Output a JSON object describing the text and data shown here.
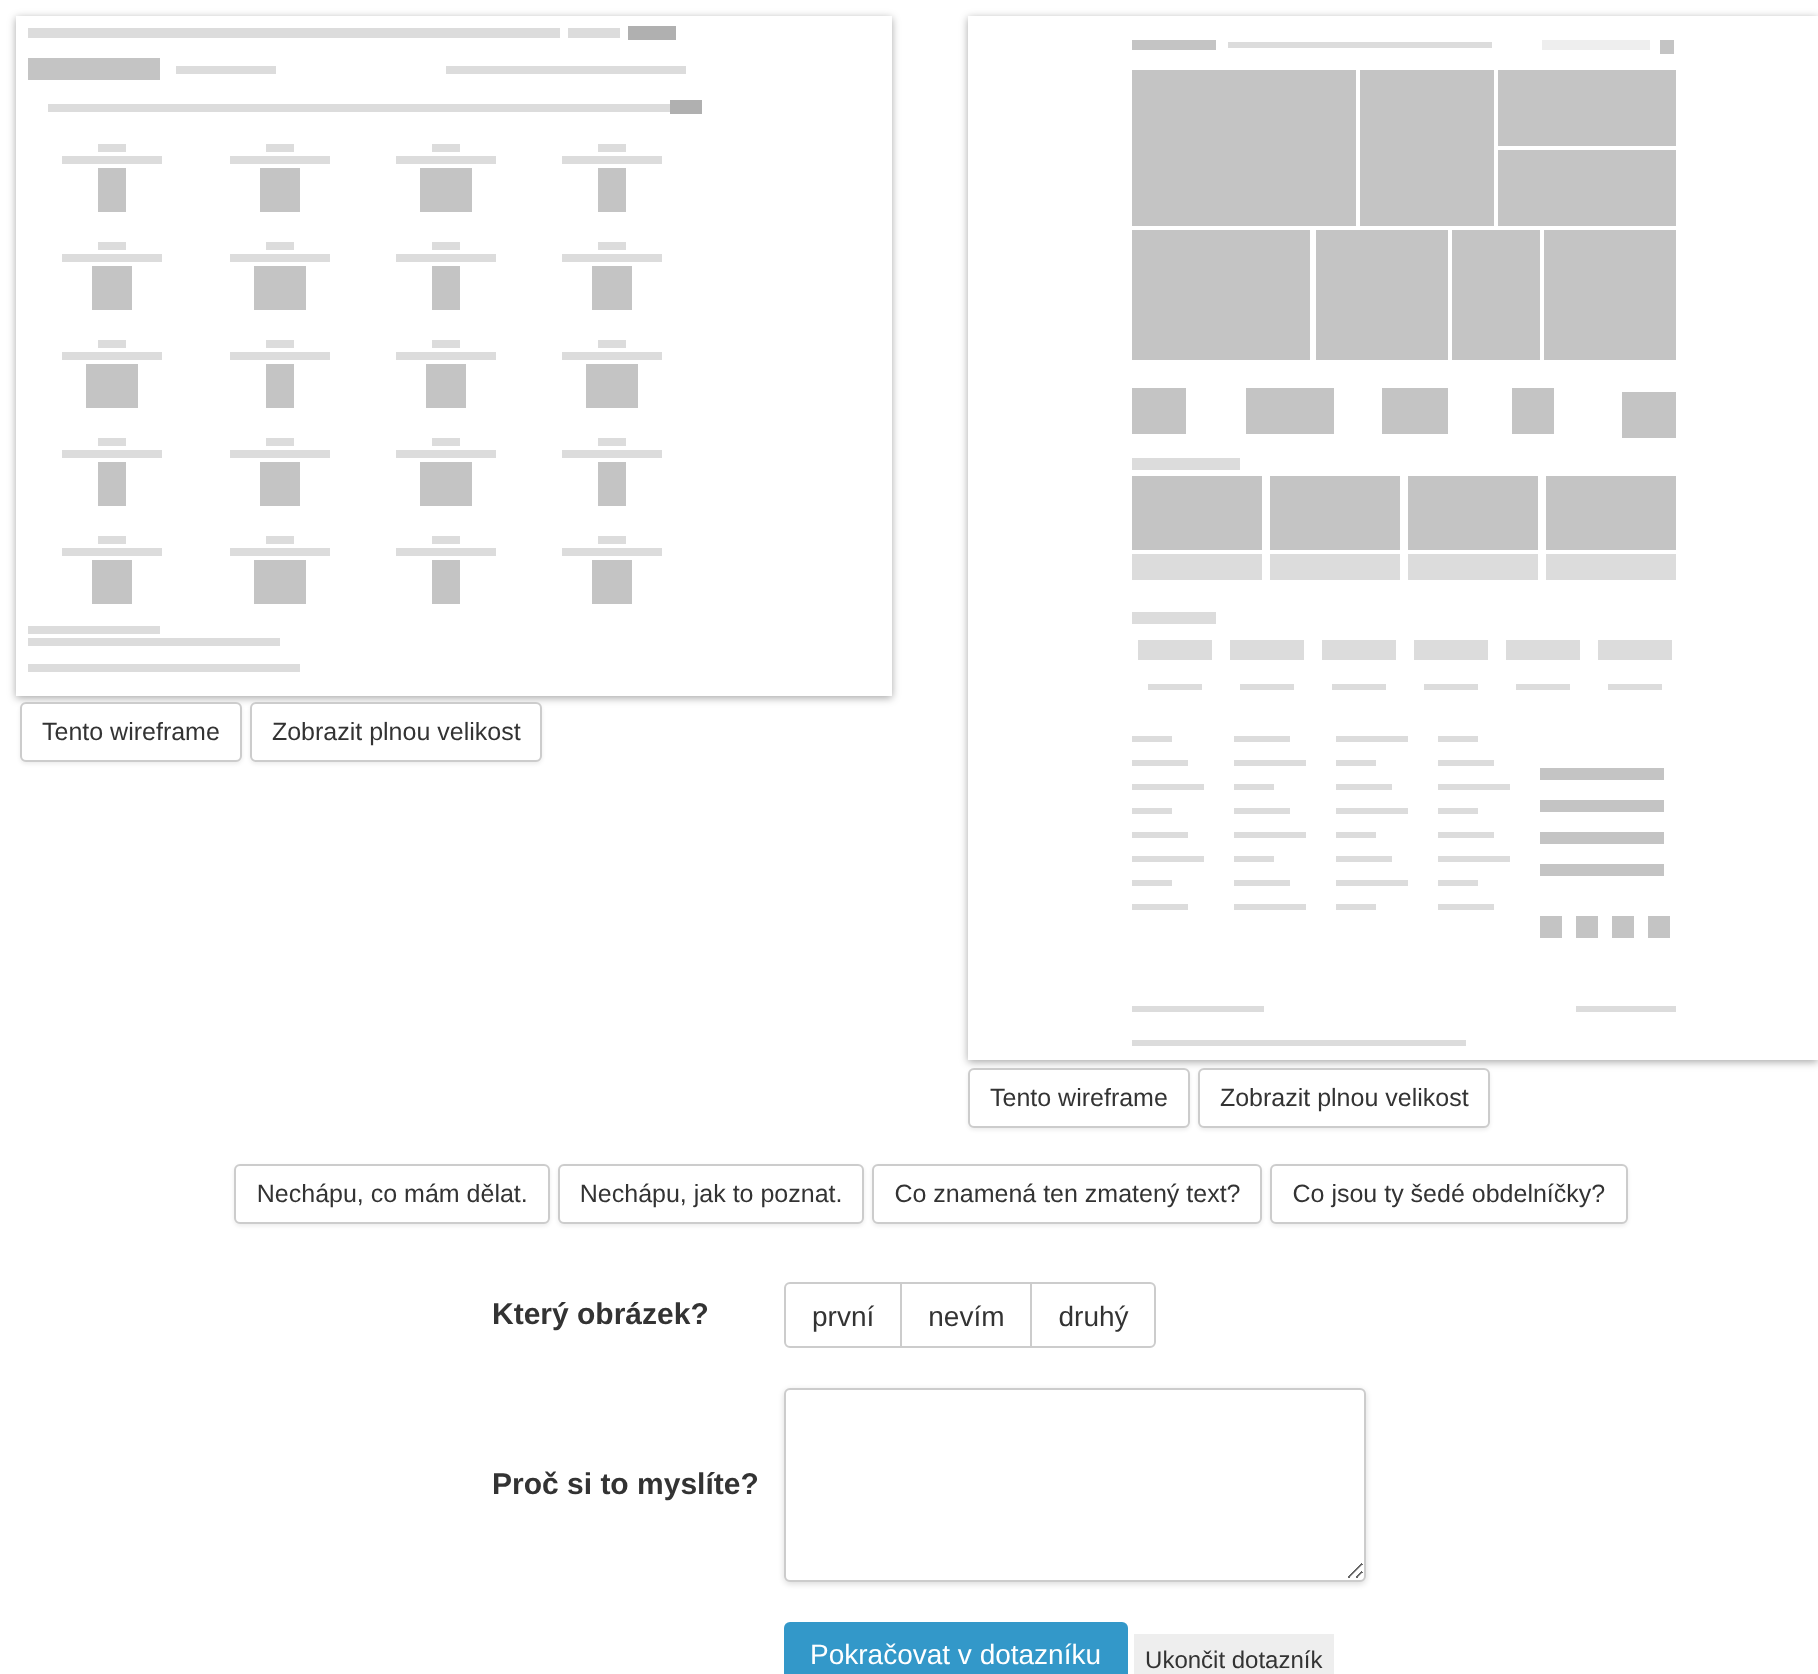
{
  "wireframes": [
    {
      "kind": "catalog",
      "buttons": [
        "Tento wireframe",
        "Zobrazit plnou velikost"
      ]
    },
    {
      "kind": "homepage",
      "buttons": [
        "Tento wireframe",
        "Zobrazit plnou velikost"
      ]
    }
  ],
  "help_buttons": [
    "Nechápu, co mám dělat.",
    "Nechápu, jak to poznat.",
    "Co znamená ten zmatený text?",
    "Co jsou ty šedé obdelníčky?"
  ],
  "question": {
    "label": "Který obrázek?",
    "options": [
      {
        "label": "první",
        "selected": false
      },
      {
        "label": "nevím",
        "selected": false
      },
      {
        "label": "druhý",
        "selected": false
      }
    ]
  },
  "reason": {
    "label": "Proč si to myslíte?"
  },
  "actions": {
    "primary": "Pokračovat v dotazníku",
    "secondary": "Ukončit dotazník"
  }
}
